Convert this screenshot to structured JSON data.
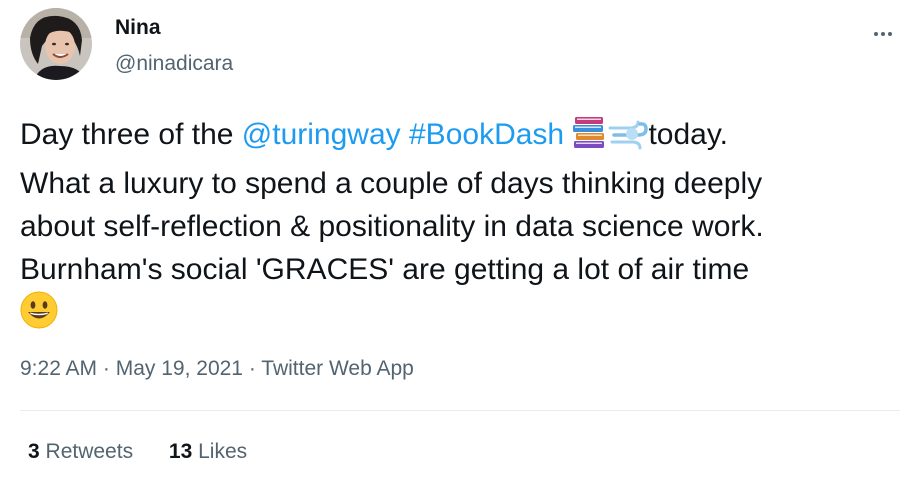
{
  "author": {
    "name": "Nina",
    "handle": "@ninadicara"
  },
  "tweet": {
    "text_before": "Day three of the ",
    "mention": "@turingway",
    "hashtag": "#BookDash",
    "emoji_books": "books-emoji",
    "emoji_wind": "dash-emoji",
    "text_line1_end": "today.",
    "line2": "What a luxury to spend a couple of days thinking deeply",
    "line3": "about self-reflection & positionality in data science work.",
    "line4": "Burnham's social 'GRACES' are getting a lot of air time",
    "emoji_smile": "grinning-face-emoji"
  },
  "meta": {
    "time": "9:22 AM",
    "sep1": " · ",
    "date": "May 19, 2021",
    "sep2": " · ",
    "app": "Twitter Web App"
  },
  "stats": {
    "retweets_count": "3",
    "retweets_label": "Retweets",
    "likes_count": "13",
    "likes_label": "Likes"
  },
  "colors": {
    "link": "#1d9bf0",
    "secondary": "#536471",
    "primary": "#0f1419"
  }
}
